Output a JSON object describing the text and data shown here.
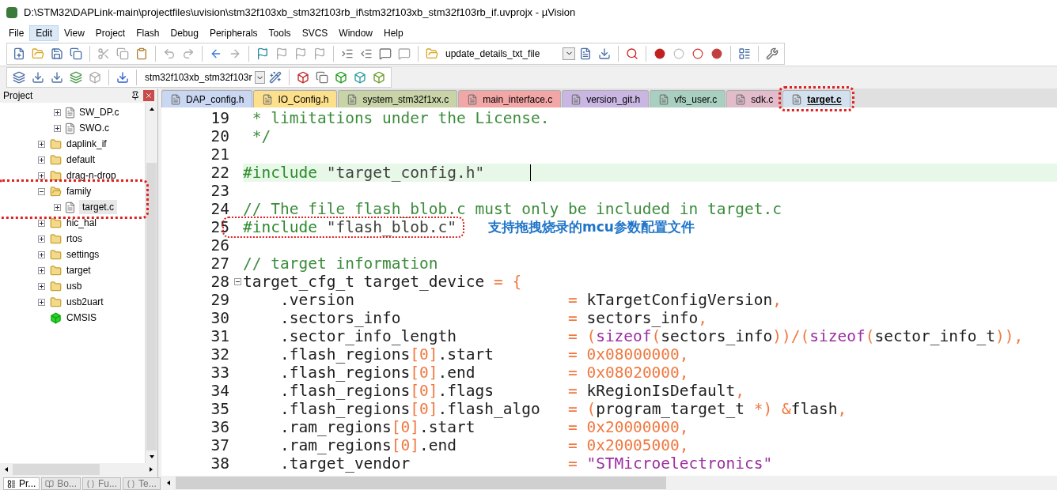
{
  "window": {
    "title": "D:\\STM32\\DAPLink-main\\projectfiles\\uvision\\stm32f103xb_stm32f103rb_if\\stm32f103xb_stm32f103rb_if.uvprojx - µVision"
  },
  "menu": [
    {
      "label": "File",
      "selected": false
    },
    {
      "label": "Edit",
      "selected": true
    },
    {
      "label": "View",
      "selected": false
    },
    {
      "label": "Project",
      "selected": false
    },
    {
      "label": "Flash",
      "selected": false
    },
    {
      "label": "Debug",
      "selected": false
    },
    {
      "label": "Peripherals",
      "selected": false
    },
    {
      "label": "Tools",
      "selected": false
    },
    {
      "label": "SVCS",
      "selected": false
    },
    {
      "label": "Window",
      "selected": false
    },
    {
      "label": "Help",
      "selected": false
    }
  ],
  "toolbar": {
    "target_combo": "update_details_txt_file"
  },
  "build_toolbar": {
    "target_combo": "stm32f103xb_stm32f103r"
  },
  "project_panel": {
    "title": "Project",
    "partial_group": [
      {
        "label": "SW_DP.c"
      },
      {
        "label": "SWO.c"
      }
    ],
    "tree": [
      {
        "label": "daplink_if",
        "kind": "folder",
        "expanded": false,
        "circled": false
      },
      {
        "label": "default",
        "kind": "folder",
        "expanded": false,
        "circled": false
      },
      {
        "label": "drag-n-drop",
        "kind": "folder",
        "expanded": false,
        "circled": false
      },
      {
        "label": "family",
        "kind": "folder",
        "expanded": true,
        "circled": true,
        "children": [
          {
            "label": "target.c",
            "selected": true
          }
        ]
      },
      {
        "label": "hic_hal",
        "kind": "folder",
        "expanded": false,
        "circled": false
      },
      {
        "label": "rtos",
        "kind": "folder",
        "expanded": false,
        "circled": false
      },
      {
        "label": "settings",
        "kind": "folder",
        "expanded": false,
        "circled": false
      },
      {
        "label": "target",
        "kind": "folder",
        "expanded": false,
        "circled": false
      },
      {
        "label": "usb",
        "kind": "folder",
        "expanded": false,
        "circled": false
      },
      {
        "label": "usb2uart",
        "kind": "folder",
        "expanded": false,
        "circled": false
      },
      {
        "label": "CMSIS",
        "kind": "component",
        "circled": false
      }
    ],
    "bottom_tabs": [
      {
        "label": "Pr...",
        "selected": true
      },
      {
        "label": "Bo...",
        "selected": false
      },
      {
        "label": "Fu...",
        "selected": false
      },
      {
        "label": "Te...",
        "selected": false
      }
    ]
  },
  "editor_tabs": [
    {
      "label": "DAP_config.h",
      "color": "#c9d7f2",
      "selected": false,
      "circled": false
    },
    {
      "label": "IO_Config.h",
      "color": "#fde08c",
      "selected": false,
      "circled": false
    },
    {
      "label": "system_stm32f1xx.c",
      "color": "#c8d4a8",
      "selected": false,
      "circled": false
    },
    {
      "label": "main_interface.c",
      "color": "#f2a6a6",
      "selected": false,
      "circled": false
    },
    {
      "label": "version_git.h",
      "color": "#c9b6e2",
      "selected": false,
      "circled": false
    },
    {
      "label": "vfs_user.c",
      "color": "#a9cfc0",
      "selected": false,
      "circled": false
    },
    {
      "label": "sdk.c",
      "color": "#e2bccb",
      "selected": false,
      "circled": false
    },
    {
      "label": "target.c",
      "color": "#d3e1ee",
      "selected": true,
      "circled": true
    }
  ],
  "code": [
    {
      "number": "19",
      "current": false,
      "circled": false,
      "tokens": [
        {
          "kind": "comment",
          "text": " * limitations under the License."
        }
      ]
    },
    {
      "number": "20",
      "current": false,
      "circled": false,
      "tokens": [
        {
          "kind": "comment",
          "text": " */"
        }
      ]
    },
    {
      "number": "21",
      "current": false,
      "circled": false
    },
    {
      "number": "22",
      "current": true,
      "circled": false,
      "tokens": [
        {
          "kind": "preprocessor",
          "text": "#include"
        },
        {
          "kind": "string",
          "text": " \"target_config.h\""
        }
      ]
    },
    {
      "number": "23",
      "current": false,
      "circled": false
    },
    {
      "number": "24",
      "current": false,
      "circled": false,
      "tokens": [
        {
          "kind": "comment",
          "text": "// The file flash_blob.c must only be included in target.c"
        }
      ]
    },
    {
      "number": "25",
      "current": false,
      "circled": true,
      "note": "支持拖拽烧录的mcu参数配置文件",
      "tokens": [
        {
          "kind": "preprocessor",
          "text": "#include"
        },
        {
          "kind": "string",
          "text": " \"flash_blob.c\""
        }
      ]
    },
    {
      "number": "26",
      "current": false,
      "circled": false
    },
    {
      "number": "27",
      "current": false,
      "circled": false,
      "tokens": [
        {
          "kind": "comment",
          "text": "// target information"
        }
      ]
    },
    {
      "number": "28",
      "current": false,
      "circled": false,
      "foldable": true,
      "tokens": [
        {
          "kind": "plain",
          "text": "target_cfg_t target_device "
        },
        {
          "kind": "operator",
          "text": "= {"
        }
      ]
    },
    {
      "number": "29",
      "current": false,
      "circled": false,
      "tokens": [
        {
          "kind": "plain",
          "text": "    .version                       "
        },
        {
          "kind": "operator",
          "text": "="
        },
        {
          "kind": "plain",
          "text": " kTargetConfigVersion"
        },
        {
          "kind": "operator",
          "text": ","
        }
      ]
    },
    {
      "number": "30",
      "current": false,
      "circled": false,
      "tokens": [
        {
          "kind": "plain",
          "text": "    .sectors_info                  "
        },
        {
          "kind": "operator",
          "text": "="
        },
        {
          "kind": "plain",
          "text": " sectors_info"
        },
        {
          "kind": "operator",
          "text": ","
        }
      ]
    },
    {
      "number": "31",
      "current": false,
      "circled": false,
      "tokens": [
        {
          "kind": "plain",
          "text": "    .sector_info_length            "
        },
        {
          "kind": "operator",
          "text": "= ("
        },
        {
          "kind": "keyword",
          "text": "sizeof"
        },
        {
          "kind": "operator",
          "text": "("
        },
        {
          "kind": "plain",
          "text": "sectors_info"
        },
        {
          "kind": "operator",
          "text": "))/("
        },
        {
          "kind": "keyword",
          "text": "sizeof"
        },
        {
          "kind": "operator",
          "text": "("
        },
        {
          "kind": "plain",
          "text": "sector_info_t"
        },
        {
          "kind": "operator",
          "text": ")),"
        }
      ]
    },
    {
      "number": "32",
      "current": false,
      "circled": false,
      "tokens": [
        {
          "kind": "plain",
          "text": "    .flash_regions"
        },
        {
          "kind": "operator",
          "text": "["
        },
        {
          "kind": "number",
          "text": "0"
        },
        {
          "kind": "operator",
          "text": "]"
        },
        {
          "kind": "plain",
          "text": ".start        "
        },
        {
          "kind": "operator",
          "text": "= "
        },
        {
          "kind": "number",
          "text": "0x08000000"
        },
        {
          "kind": "operator",
          "text": ","
        }
      ]
    },
    {
      "number": "33",
      "current": false,
      "circled": false,
      "tokens": [
        {
          "kind": "plain",
          "text": "    .flash_regions"
        },
        {
          "kind": "operator",
          "text": "["
        },
        {
          "kind": "number",
          "text": "0"
        },
        {
          "kind": "operator",
          "text": "]"
        },
        {
          "kind": "plain",
          "text": ".end          "
        },
        {
          "kind": "operator",
          "text": "= "
        },
        {
          "kind": "number",
          "text": "0x08020000"
        },
        {
          "kind": "operator",
          "text": ","
        }
      ]
    },
    {
      "number": "34",
      "current": false,
      "circled": false,
      "tokens": [
        {
          "kind": "plain",
          "text": "    .flash_regions"
        },
        {
          "kind": "operator",
          "text": "["
        },
        {
          "kind": "number",
          "text": "0"
        },
        {
          "kind": "operator",
          "text": "]"
        },
        {
          "kind": "plain",
          "text": ".flags        "
        },
        {
          "kind": "operator",
          "text": "="
        },
        {
          "kind": "plain",
          "text": " kRegionIsDefault"
        },
        {
          "kind": "operator",
          "text": ","
        }
      ]
    },
    {
      "number": "35",
      "current": false,
      "circled": false,
      "tokens": [
        {
          "kind": "plain",
          "text": "    .flash_regions"
        },
        {
          "kind": "operator",
          "text": "["
        },
        {
          "kind": "number",
          "text": "0"
        },
        {
          "kind": "operator",
          "text": "]"
        },
        {
          "kind": "plain",
          "text": ".flash_algo   "
        },
        {
          "kind": "operator",
          "text": "= ("
        },
        {
          "kind": "plain",
          "text": "program_target_t "
        },
        {
          "kind": "operator",
          "text": "*) &"
        },
        {
          "kind": "plain",
          "text": "flash"
        },
        {
          "kind": "operator",
          "text": ","
        }
      ]
    },
    {
      "number": "36",
      "current": false,
      "circled": false,
      "tokens": [
        {
          "kind": "plain",
          "text": "    .ram_regions"
        },
        {
          "kind": "operator",
          "text": "["
        },
        {
          "kind": "number",
          "text": "0"
        },
        {
          "kind": "operator",
          "text": "]"
        },
        {
          "kind": "plain",
          "text": ".start          "
        },
        {
          "kind": "operator",
          "text": "= "
        },
        {
          "kind": "number",
          "text": "0x20000000"
        },
        {
          "kind": "operator",
          "text": ","
        }
      ]
    },
    {
      "number": "37",
      "current": false,
      "circled": false,
      "tokens": [
        {
          "kind": "plain",
          "text": "    .ram_regions"
        },
        {
          "kind": "operator",
          "text": "["
        },
        {
          "kind": "number",
          "text": "0"
        },
        {
          "kind": "operator",
          "text": "]"
        },
        {
          "kind": "plain",
          "text": ".end            "
        },
        {
          "kind": "operator",
          "text": "= "
        },
        {
          "kind": "number",
          "text": "0x20005000"
        },
        {
          "kind": "operator",
          "text": ","
        }
      ]
    },
    {
      "number": "38",
      "current": false,
      "circled": false,
      "tokens": [
        {
          "kind": "plain",
          "text": "    .target_vendor                 "
        },
        {
          "kind": "operator",
          "text": "= "
        },
        {
          "kind": "string2",
          "text": "\"STMicroelectronics\""
        }
      ]
    }
  ]
}
